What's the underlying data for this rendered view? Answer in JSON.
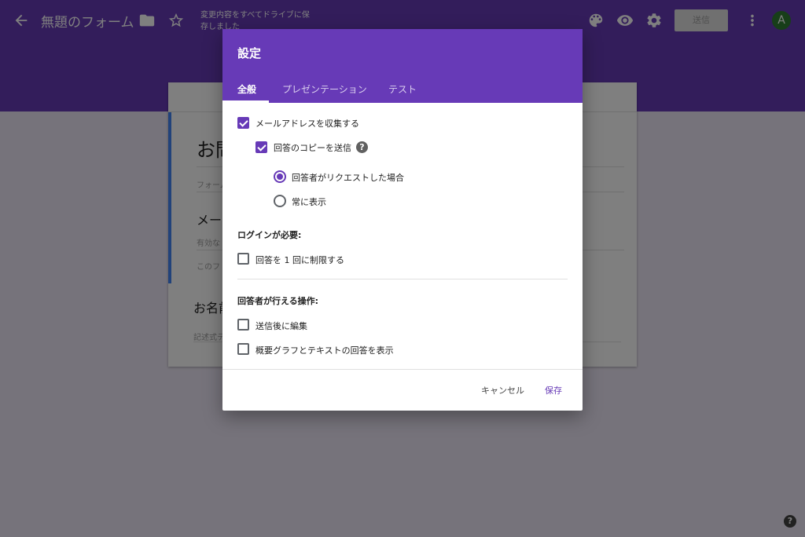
{
  "app": {
    "form_title": "無題のフォーム",
    "save_status": "変更内容をすべてドライブに保存しました",
    "send_label": "送信",
    "avatar_letter": "A"
  },
  "form": {
    "title": "お問",
    "description": "フォーム",
    "questions": [
      {
        "title": "メール",
        "sub1": "有効な",
        "sub2": "このフ"
      },
      {
        "title": "お名前",
        "sub1": "記述式テ"
      }
    ]
  },
  "dialog": {
    "title": "設定",
    "tabs": [
      "全般",
      "プレゼンテーション",
      "テスト"
    ],
    "collect_email": "メールアドレスを収集する",
    "send_copy": "回答のコピーを送信",
    "help": "?",
    "radio_on_request": "回答者がリクエストした場合",
    "radio_always": "常に表示",
    "login_required": "ログインが必要:",
    "limit_one": "回答を 1 回に制限する",
    "respondent_can": "回答者が行える操作:",
    "edit_after": "送信後に編集",
    "see_summary": "概要グラフとテキストの回答を表示",
    "cancel": "キャンセル",
    "save": "保存"
  },
  "colors": {
    "accent": "#673ab7",
    "form_card_border": "#4285f4"
  },
  "icons": {
    "back": "arrow-left-icon",
    "folder": "folder-icon",
    "star": "star-icon",
    "palette": "palette-icon",
    "preview": "eye-icon",
    "settings": "gear-icon",
    "more": "more-vert-icon",
    "help": "question-circle-icon"
  }
}
